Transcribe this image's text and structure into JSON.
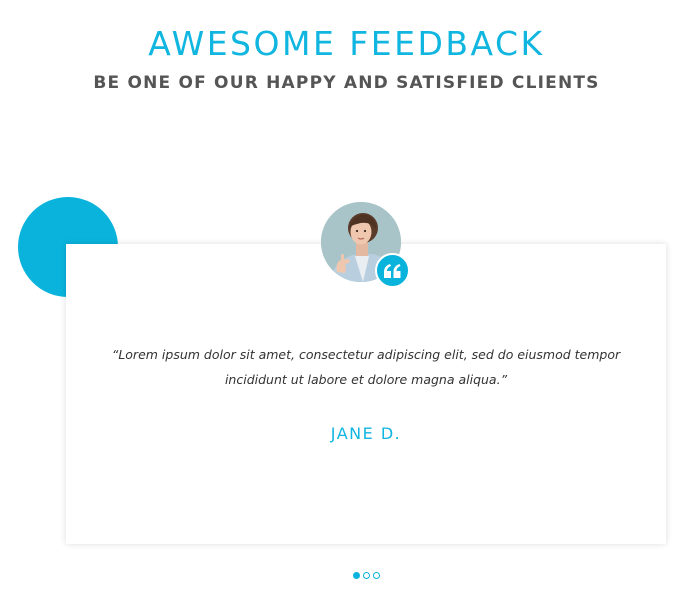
{
  "header": {
    "title": "AWESOME FEEDBACK",
    "subtitle": "BE ONE OF OUR HAPPY AND SATISFIED CLIENTS"
  },
  "testimonial": {
    "quote": "“Lorem ipsum dolor sit amet, consectetur adipiscing elit, sed do eiusmod tempor incididunt ut labore et dolore magna aliqua.”",
    "author": "JANE D.",
    "avatar_icon": "person-photo",
    "quote_icon": "quote-icon"
  },
  "carousel": {
    "slides": 3,
    "active_index": 0
  },
  "colors": {
    "accent": "#0ab3dc",
    "subtitle_text": "#555555",
    "body_text": "#333333"
  }
}
